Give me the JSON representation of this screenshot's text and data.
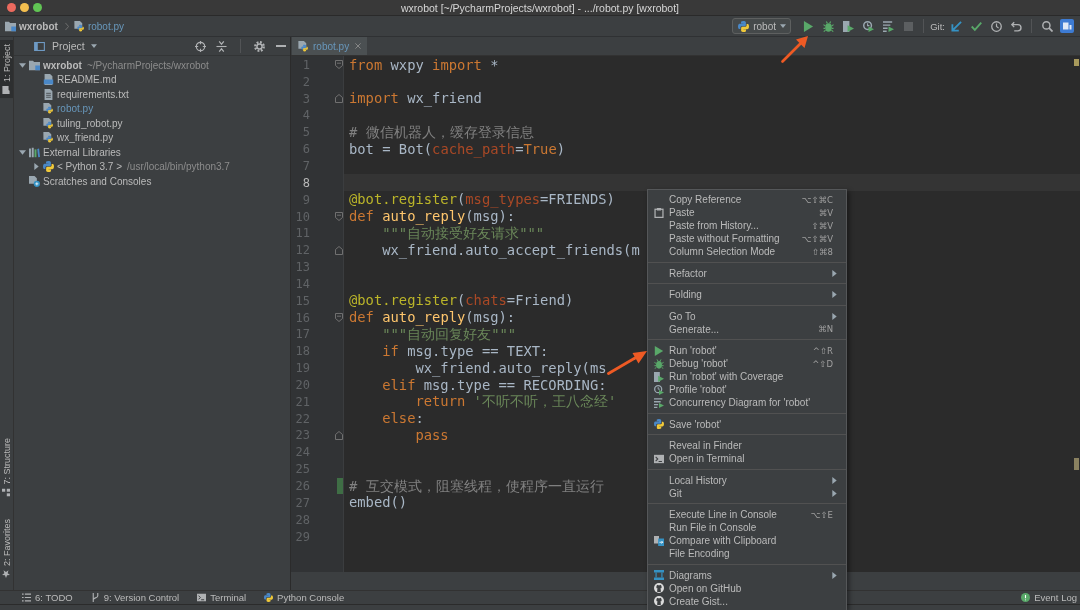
{
  "window": {
    "title": "wxrobot [~/PycharmProjects/wxrobot] - .../robot.py [wxrobot]"
  },
  "navigation_bar": {
    "breadcrumbs": [
      {
        "label": "wxrobot",
        "kind": "module",
        "modified": false
      },
      {
        "label": "robot.py",
        "kind": "python",
        "modified": true
      }
    ],
    "run_configuration": "robot",
    "run_toolbar": [
      {
        "kind": "run",
        "disabled": false
      },
      {
        "kind": "debug",
        "disabled": false
      },
      {
        "kind": "coverage",
        "disabled": false
      },
      {
        "kind": "profile",
        "disabled": false
      },
      {
        "kind": "concurrency",
        "disabled": false
      },
      {
        "kind": "stop",
        "disabled": true
      }
    ],
    "git_toolbar": {
      "label": "Git:",
      "buttons": [
        {
          "kind": "update"
        },
        {
          "kind": "commit"
        },
        {
          "kind": "history"
        },
        {
          "kind": "revert"
        }
      ]
    },
    "right_toolbar": [
      {
        "kind": "search"
      },
      {
        "kind": "tile"
      }
    ]
  },
  "left_tool_stripe": {
    "top": [
      {
        "label": "1: Project",
        "kind": "project",
        "selected": true
      }
    ],
    "bottom": [
      {
        "label": "7: Structure",
        "kind": "structure",
        "selected": false
      },
      {
        "label": "2: Favorites",
        "kind": "favorites",
        "selected": false
      }
    ]
  },
  "project_panel": {
    "title": "Project",
    "tree": [
      {
        "label": "wxrobot",
        "detail": "~/PycharmProjects/wxrobot",
        "kind": "module",
        "expanded": true,
        "children": [
          {
            "label": "README.md",
            "kind": "markdown",
            "modified": false
          },
          {
            "label": "requirements.txt",
            "kind": "text",
            "modified": false
          },
          {
            "label": "robot.py",
            "kind": "python",
            "modified": true
          },
          {
            "label": "tuling_robot.py",
            "kind": "python",
            "modified": false
          },
          {
            "label": "wx_friend.py",
            "kind": "python",
            "modified": false
          }
        ]
      },
      {
        "label": "External Libraries",
        "kind": "libraries",
        "expanded": true,
        "children": [
          {
            "label": "< Python 3.7 >",
            "detail": "/usr/local/bin/python3.7",
            "kind": "sdk",
            "expanded": false
          }
        ]
      },
      {
        "label": "Scratches and Consoles",
        "kind": "scratches"
      }
    ]
  },
  "editor": {
    "tabs": [
      {
        "label": "robot.py",
        "kind": "python",
        "selected": true,
        "modified": true
      }
    ],
    "lines": [
      {
        "number": "1",
        "kind": "opener",
        "current": false,
        "changed": false,
        "tokens": [
          {
            "text": "from",
            "kind": "keyword"
          },
          {
            "text": " wxpy ",
            "kind": "plain"
          },
          {
            "text": "import",
            "kind": "keyword"
          },
          {
            "text": " *",
            "kind": "plain"
          }
        ]
      },
      {
        "number": "2",
        "kind": "plain",
        "current": false,
        "changed": false
      },
      {
        "number": "3",
        "kind": "closer",
        "current": false,
        "changed": false,
        "tokens": [
          {
            "text": "import",
            "kind": "keyword"
          },
          {
            "text": " wx_friend",
            "kind": "plain"
          }
        ]
      },
      {
        "number": "4",
        "kind": "plain",
        "current": false,
        "changed": false
      },
      {
        "number": "5",
        "kind": "plain",
        "current": false,
        "changed": false,
        "tokens": [
          {
            "text": "# 微信机器人，缓存登录信息",
            "kind": "comment"
          }
        ]
      },
      {
        "number": "6",
        "kind": "plain",
        "current": false,
        "changed": false,
        "tokens": [
          {
            "text": "bot = Bot(",
            "kind": "plain"
          },
          {
            "text": "cache_path",
            "kind": "param"
          },
          {
            "text": "=",
            "kind": "plain"
          },
          {
            "text": "True",
            "kind": "keyword"
          },
          {
            "text": ")",
            "kind": "plain"
          }
        ]
      },
      {
        "number": "7",
        "kind": "plain",
        "current": false,
        "changed": false
      },
      {
        "number": "8",
        "kind": "plain",
        "current": true,
        "changed": false
      },
      {
        "number": "9",
        "kind": "plain",
        "current": false,
        "changed": false,
        "tokens": [
          {
            "text": "@bot.register",
            "kind": "decorator"
          },
          {
            "text": "(",
            "kind": "plain"
          },
          {
            "text": "msg_types",
            "kind": "param"
          },
          {
            "text": "=FRIENDS)",
            "kind": "plain"
          }
        ]
      },
      {
        "number": "10",
        "kind": "opener",
        "current": false,
        "changed": false,
        "tokens": [
          {
            "text": "def ",
            "kind": "keyword"
          },
          {
            "text": "auto_reply",
            "kind": "function"
          },
          {
            "text": "(msg):",
            "kind": "plain"
          }
        ]
      },
      {
        "number": "11",
        "kind": "plain",
        "current": false,
        "changed": false,
        "tokens": [
          {
            "text": "    \"\"\"自动接受好友请求\"\"\"",
            "kind": "string"
          }
        ]
      },
      {
        "number": "12",
        "kind": "closer",
        "current": false,
        "changed": false,
        "tokens": [
          {
            "text": "    wx_friend.auto_accept_friends(m",
            "kind": "plain"
          }
        ]
      },
      {
        "number": "13",
        "kind": "plain",
        "current": false,
        "changed": false
      },
      {
        "number": "14",
        "kind": "plain",
        "current": false,
        "changed": false
      },
      {
        "number": "15",
        "kind": "plain",
        "current": false,
        "changed": false,
        "tokens": [
          {
            "text": "@bot.register",
            "kind": "decorator"
          },
          {
            "text": "(",
            "kind": "plain"
          },
          {
            "text": "chats",
            "kind": "param"
          },
          {
            "text": "=Friend)",
            "kind": "plain"
          }
        ]
      },
      {
        "number": "16",
        "kind": "opener",
        "current": false,
        "changed": false,
        "tokens": [
          {
            "text": "def ",
            "kind": "keyword"
          },
          {
            "text": "auto_reply",
            "kind": "function"
          },
          {
            "text": "(msg):",
            "kind": "plain"
          }
        ]
      },
      {
        "number": "17",
        "kind": "plain",
        "current": false,
        "changed": false,
        "tokens": [
          {
            "text": "    \"\"\"自动回复好友\"\"\"",
            "kind": "string"
          }
        ]
      },
      {
        "number": "18",
        "kind": "plain",
        "current": false,
        "changed": false,
        "tokens": [
          {
            "text": "    if",
            "kind": "keyword"
          },
          {
            "text": " msg.type == TEXT:",
            "kind": "plain"
          }
        ]
      },
      {
        "number": "19",
        "kind": "plain",
        "current": false,
        "changed": false,
        "tokens": [
          {
            "text": "        wx_friend.auto_reply(ms",
            "kind": "plain"
          }
        ]
      },
      {
        "number": "20",
        "kind": "plain",
        "current": false,
        "changed": false,
        "tokens": [
          {
            "text": "    elif",
            "kind": "keyword"
          },
          {
            "text": " msg.type == RECORDING:",
            "kind": "plain"
          }
        ]
      },
      {
        "number": "21",
        "kind": "plain",
        "current": false,
        "changed": false,
        "tokens": [
          {
            "text": "        return ",
            "kind": "keyword"
          },
          {
            "text": "'不听不听，王八念经'",
            "kind": "string"
          }
        ]
      },
      {
        "number": "22",
        "kind": "plain",
        "current": false,
        "changed": false,
        "tokens": [
          {
            "text": "    else",
            "kind": "keyword"
          },
          {
            "text": ":",
            "kind": "plain"
          }
        ]
      },
      {
        "number": "23",
        "kind": "closer",
        "current": false,
        "changed": false,
        "tokens": [
          {
            "text": "        pass",
            "kind": "keyword"
          }
        ]
      },
      {
        "number": "24",
        "kind": "plain",
        "current": false,
        "changed": false
      },
      {
        "number": "25",
        "kind": "plain",
        "current": false,
        "changed": false
      },
      {
        "number": "26",
        "kind": "plain",
        "current": false,
        "changed": true,
        "tokens": [
          {
            "text": "# 互交模式，阻塞线程，使程序一直运行",
            "kind": "comment"
          }
        ]
      },
      {
        "number": "27",
        "kind": "plain",
        "current": false,
        "changed": false,
        "tokens": [
          {
            "text": "embed()",
            "kind": "plain"
          }
        ]
      },
      {
        "number": "28",
        "kind": "plain",
        "current": false,
        "changed": false
      },
      {
        "number": "29",
        "kind": "plain",
        "current": false,
        "changed": false
      }
    ]
  },
  "context_menu": {
    "groups": [
      {
        "items": [
          {
            "label": "Copy Reference",
            "shortcut": "⌥⇧⌘C",
            "kind": "plain",
            "submenu": false
          },
          {
            "label": "Paste",
            "shortcut": "⌘V",
            "kind": "paste",
            "submenu": false
          },
          {
            "label": "Paste from History...",
            "shortcut": "⇧⌘V",
            "kind": "plain",
            "submenu": false
          },
          {
            "label": "Paste without Formatting",
            "shortcut": "⌥⇧⌘V",
            "kind": "plain",
            "submenu": false
          },
          {
            "label": "Column Selection Mode",
            "shortcut": "⇧⌘8",
            "kind": "plain",
            "submenu": false
          }
        ]
      },
      {
        "items": [
          {
            "label": "Refactor",
            "kind": "plain",
            "submenu": true
          }
        ]
      },
      {
        "items": [
          {
            "label": "Folding",
            "kind": "plain",
            "submenu": true
          }
        ]
      },
      {
        "items": [
          {
            "label": "Go To",
            "kind": "plain",
            "submenu": true
          },
          {
            "label": "Generate...",
            "shortcut": "⌘N",
            "kind": "plain",
            "submenu": false
          }
        ]
      },
      {
        "items": [
          {
            "label": "Run 'robot'",
            "shortcut": "^⇧R",
            "kind": "run",
            "submenu": false
          },
          {
            "label": "Debug 'robot'",
            "shortcut": "^⇧D",
            "kind": "debug",
            "submenu": false
          },
          {
            "label": "Run 'robot' with Coverage",
            "kind": "coverage",
            "submenu": false
          },
          {
            "label": "Profile 'robot'",
            "kind": "profile",
            "submenu": false
          },
          {
            "label": "Concurrency Diagram for 'robot'",
            "kind": "concurrency",
            "submenu": false
          }
        ]
      },
      {
        "items": [
          {
            "label": "Save 'robot'",
            "kind": "python",
            "submenu": false
          }
        ]
      },
      {
        "items": [
          {
            "label": "Reveal in Finder",
            "kind": "plain",
            "submenu": false
          },
          {
            "label": "Open in Terminal",
            "kind": "terminal",
            "submenu": false
          }
        ]
      },
      {
        "items": [
          {
            "label": "Local History",
            "kind": "plain",
            "submenu": true
          },
          {
            "label": "Git",
            "kind": "plain",
            "submenu": true
          }
        ]
      },
      {
        "items": [
          {
            "label": "Execute Line in Console",
            "shortcut": "⌥⇧E",
            "kind": "plain",
            "submenu": false
          },
          {
            "label": "Run File in Console",
            "kind": "plain",
            "submenu": false
          },
          {
            "label": "Compare with Clipboard",
            "kind": "compare",
            "submenu": false
          },
          {
            "label": "File Encoding",
            "kind": "plain",
            "submenu": false
          }
        ]
      },
      {
        "items": [
          {
            "label": "Diagrams",
            "kind": "diagram",
            "submenu": true
          },
          {
            "label": "Open on GitHub",
            "kind": "github",
            "submenu": false
          },
          {
            "label": "Create Gist...",
            "kind": "github",
            "submenu": false
          }
        ]
      }
    ]
  },
  "tool_window_bar": {
    "buttons": [
      {
        "label": "6: TODO",
        "kind": "todo"
      },
      {
        "label": "9: Version Control",
        "kind": "vcs"
      },
      {
        "label": "Terminal",
        "kind": "terminal"
      },
      {
        "label": "Python Console",
        "kind": "python"
      }
    ],
    "event_log": "Event Log"
  }
}
